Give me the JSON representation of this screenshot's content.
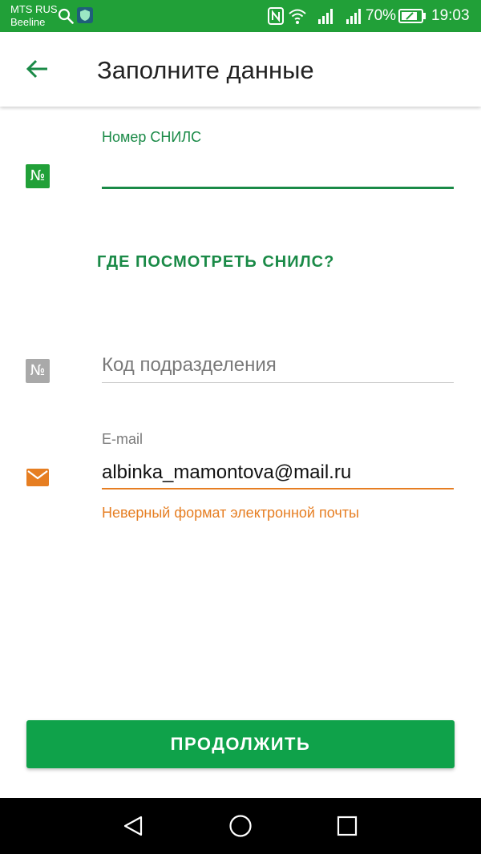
{
  "status_bar": {
    "carrier_primary": "MTS RUS",
    "carrier_secondary": "Beeline",
    "battery_percent": "70%",
    "time": "19:03",
    "color": "#21a038"
  },
  "app_bar": {
    "title": "Заполните данные",
    "back_icon": "arrow-left-icon"
  },
  "form": {
    "snils": {
      "label": "Номер СНИЛС",
      "value": "",
      "icon_text": "№",
      "state": "focused"
    },
    "where_snils_link": "ГДЕ ПОСМОТРЕТЬ СНИЛС?",
    "division_code": {
      "placeholder": "Код подразделения",
      "value": "",
      "icon_text": "№"
    },
    "email": {
      "label": "E-mail",
      "value": "albinka_mamontova@mail.ru",
      "icon": "mail-icon",
      "error": "Неверный формат электронной почты",
      "state": "error"
    }
  },
  "continue_button": {
    "label": "ПРОДОЛЖИТЬ"
  },
  "colors": {
    "primary_green": "#21a038",
    "button_green": "#0fa24a",
    "link_green": "#1a8a47",
    "error_orange": "#e67e22",
    "inactive_grey": "#a9a9a9"
  }
}
